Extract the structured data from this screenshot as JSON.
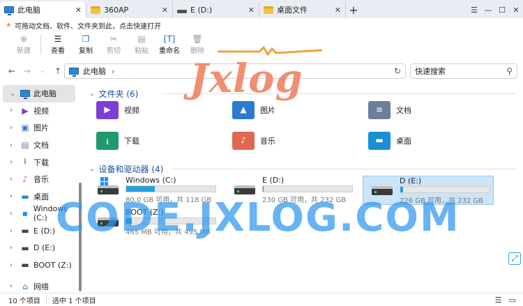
{
  "tabs": [
    {
      "label": "此电脑",
      "icon": "pc-icon",
      "active": true
    },
    {
      "label": "360AP",
      "icon": "folder-icon",
      "active": false
    },
    {
      "label": "E (D:)",
      "icon": "drive-icon",
      "active": false
    },
    {
      "label": "桌面文件",
      "icon": "folder-icon",
      "active": false
    }
  ],
  "new_tab": "+",
  "window_controls": {
    "menu": "☰",
    "minimize": "—",
    "maximize": "☐",
    "close": "✕"
  },
  "infobar_text": "可拖动文档、软件、文件夹到此，点击快速打开",
  "ribbon": {
    "new": "新建",
    "view": "查看",
    "copy": "复制",
    "cut": "剪切",
    "paste": "粘贴",
    "rename": "重命名",
    "delete": "删除"
  },
  "address": {
    "crumb": "此电脑",
    "sep": "›"
  },
  "search_placeholder": "快速搜索",
  "sidebar": [
    {
      "label": "此电脑",
      "icon": "pc-icon",
      "selected": true,
      "chev": "⌄"
    },
    {
      "label": "视频",
      "icon": "video-icon",
      "selected": false,
      "chev": "›"
    },
    {
      "label": "图片",
      "icon": "picture-icon",
      "selected": false,
      "chev": "›"
    },
    {
      "label": "文档",
      "icon": "document-icon",
      "selected": false,
      "chev": "›"
    },
    {
      "label": "下载",
      "icon": "download-icon",
      "selected": false,
      "chev": "›"
    },
    {
      "label": "音乐",
      "icon": "music-icon",
      "selected": false,
      "chev": "›"
    },
    {
      "label": "桌面",
      "icon": "desktop-icon",
      "selected": false,
      "chev": "›"
    },
    {
      "label": "Windows (C:)",
      "icon": "windows-drive-icon",
      "selected": false,
      "chev": "›"
    },
    {
      "label": "E (D:)",
      "icon": "drive-icon",
      "selected": false,
      "chev": "›"
    },
    {
      "label": "D (E:)",
      "icon": "drive-icon",
      "selected": false,
      "chev": "›"
    },
    {
      "label": "BOOT (Z:)",
      "icon": "drive-icon",
      "selected": false,
      "chev": "›"
    },
    {
      "label": "网络",
      "icon": "network-icon",
      "selected": false,
      "chev": "›"
    }
  ],
  "folders_header": "文件夹 (6)",
  "folders": [
    {
      "label": "视频",
      "icon": "video-folder-icon",
      "color": "#7b3fd1"
    },
    {
      "label": "图片",
      "icon": "pictures-folder-icon",
      "color": "#2b7bd0"
    },
    {
      "label": "文档",
      "icon": "documents-folder-icon",
      "color": "#6b7f9c"
    },
    {
      "label": "下载",
      "icon": "downloads-folder-icon",
      "color": "#1f9a6b"
    },
    {
      "label": "音乐",
      "icon": "music-folder-icon",
      "color": "#e0684f"
    },
    {
      "label": "桌面",
      "icon": "desktop-folder-icon",
      "color": "#1a8fd6"
    }
  ],
  "drives_header": "设备和驱动器 (4)",
  "drives": [
    {
      "name": "Windows (C:)",
      "free": "80.0 GB 可用，共 118 GB",
      "used_fraction": 0.32,
      "selected": false,
      "system": true
    },
    {
      "name": "E (D:)",
      "free": "230 GB 可用，共 232 GB",
      "used_fraction": 0.01,
      "selected": false,
      "system": false
    },
    {
      "name": "D (E:)",
      "free": "226 GB 可用，共 232 GB",
      "used_fraction": 0.03,
      "selected": true,
      "system": false
    },
    {
      "name": "BOOT (Z:)",
      "free": "465 MB 可用，共 495 MB",
      "used_fraction": 0.06,
      "selected": false,
      "system": false
    }
  ],
  "status": {
    "count": "10 个项目",
    "selected": "选中 1 个项目"
  },
  "watermarks": {
    "logo": "Jxlog",
    "site": "CODE.JXLOG.COM"
  },
  "colors": {
    "accent": "#26a0da",
    "selection": "#cce4f7",
    "header_text": "#1a4fa0"
  }
}
